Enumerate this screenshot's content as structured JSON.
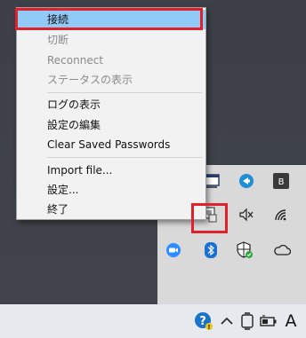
{
  "context_menu": {
    "items": [
      {
        "label": "接続",
        "state": "selected"
      },
      {
        "label": "切断",
        "state": "disabled"
      },
      {
        "label": "Reconnect",
        "state": "disabled"
      },
      {
        "label": "ステータスの表示",
        "state": "disabled"
      },
      {
        "label": "ログの表示",
        "state": "enabled"
      },
      {
        "label": "設定の編集",
        "state": "enabled"
      },
      {
        "label": "Clear Saved Passwords",
        "state": "enabled"
      },
      {
        "label": "Import file...",
        "state": "enabled"
      },
      {
        "label": "設定...",
        "state": "enabled"
      },
      {
        "label": "終了",
        "state": "enabled"
      }
    ]
  },
  "tray_overflow": {
    "icons": [
      "window-app-icon",
      "teamviewer-arrow-icon",
      "bd-app-icon",
      "vpn-gui-icon",
      "speaker-muted-icon",
      "wifi-icon",
      "zoom-camera-icon",
      "bluetooth-icon",
      "defender-shield-icon",
      "onedrive-cloud-icon"
    ]
  },
  "taskbar": {
    "ime_label": "A",
    "icons": [
      "help-icon",
      "chevron-up-icon",
      "screen-device-icon",
      "battery-icon"
    ]
  },
  "colors": {
    "highlight_border": "#e0202b",
    "menu_selected": "#91c9f7",
    "menu_background": "#f2f2f2",
    "tray_background": "#d9d9d9",
    "taskbar_background": "#e6e9ee"
  }
}
